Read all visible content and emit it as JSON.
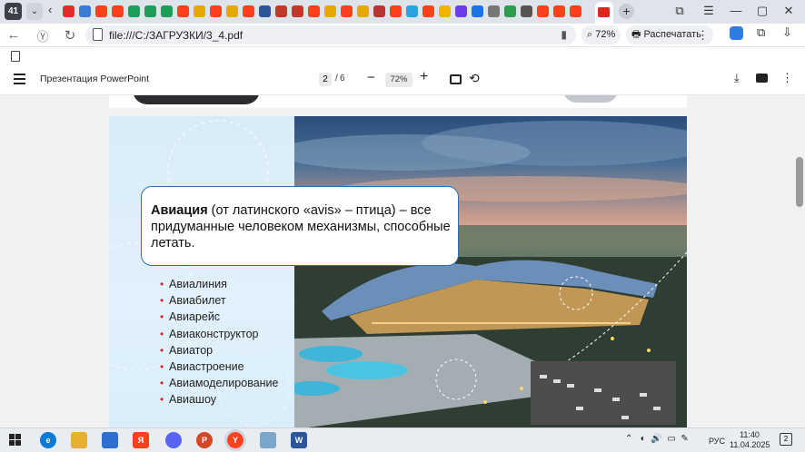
{
  "browser": {
    "tab_count": "41",
    "url": "file:///C:/ЗАГРУЗКИ/3_4.pdf",
    "zoom_label": "72%",
    "print_label": "Распечатать",
    "tab_favicons": [
      {
        "name": "tab-favicon-youtube",
        "color": "#e52d27"
      },
      {
        "name": "tab-favicon-photo",
        "color": "#3a7bd5"
      },
      {
        "name": "tab-favicon-yandex",
        "color": "#fc3f1d"
      },
      {
        "name": "tab-favicon-yandex",
        "color": "#fc3f1d"
      },
      {
        "name": "tab-favicon-green",
        "color": "#1e9e5a"
      },
      {
        "name": "tab-favicon-green",
        "color": "#1e9e5a"
      },
      {
        "name": "tab-favicon-green",
        "color": "#1e9e5a"
      },
      {
        "name": "tab-favicon-yandex",
        "color": "#fc3f1d"
      },
      {
        "name": "tab-favicon-folder",
        "color": "#e5a700"
      },
      {
        "name": "tab-favicon-yandex",
        "color": "#fc3f1d"
      },
      {
        "name": "tab-favicon-folder",
        "color": "#e5a700"
      },
      {
        "name": "tab-favicon-yandex",
        "color": "#fc3f1d"
      },
      {
        "name": "tab-favicon-word",
        "color": "#2b579a"
      },
      {
        "name": "tab-favicon-target",
        "color": "#c0392b"
      },
      {
        "name": "tab-favicon-doc",
        "color": "#c0392b"
      },
      {
        "name": "tab-favicon-yandex",
        "color": "#fc3f1d"
      },
      {
        "name": "tab-favicon-folder",
        "color": "#e5a700"
      },
      {
        "name": "tab-favicon-yandex",
        "color": "#fc3f1d"
      },
      {
        "name": "tab-favicon-folder",
        "color": "#e5a700"
      },
      {
        "name": "tab-favicon-slash",
        "color": "#b33"
      },
      {
        "name": "tab-favicon-yandex",
        "color": "#fc3f1d"
      },
      {
        "name": "tab-favicon-telegram",
        "color": "#2aa3df"
      },
      {
        "name": "tab-favicon-yandex",
        "color": "#fc3f1d"
      },
      {
        "name": "tab-favicon-play",
        "color": "#f0b400"
      },
      {
        "name": "tab-favicon-music",
        "color": "#6a3de8"
      },
      {
        "name": "tab-favicon-blue",
        "color": "#1a73e8"
      },
      {
        "name": "tab-favicon-doc",
        "color": "#777"
      },
      {
        "name": "tab-favicon-check",
        "color": "#2e9b4d"
      },
      {
        "name": "tab-favicon-puzzle",
        "color": "#555"
      },
      {
        "name": "tab-favicon-yandex-browser",
        "color": "#fc3f1d"
      },
      {
        "name": "tab-favicon-yandex",
        "color": "#fc3f1d"
      },
      {
        "name": "tab-favicon-yandex",
        "color": "#fc3f1d"
      }
    ]
  },
  "pdf": {
    "title": "Презентация PowerPoint",
    "current_page": "2",
    "page_separator": "/",
    "total_pages": "6",
    "zoom": "72%"
  },
  "slide": {
    "callout_term": "Авиация",
    "callout_rest": "  (от латинского «avis» – птица) – все придуманные человеком механизмы, способные летать.",
    "bullets": [
      "Авиалиния",
      "Авиабилет",
      "Авиарейс",
      "Авиаконструктор",
      "Авиатор",
      "Авиастроение",
      "Авиамоделирование",
      "Авиашоу"
    ]
  },
  "taskbar": {
    "language": "РУС",
    "time": "11:40",
    "date": "11.04.2025",
    "notifications": "2"
  }
}
